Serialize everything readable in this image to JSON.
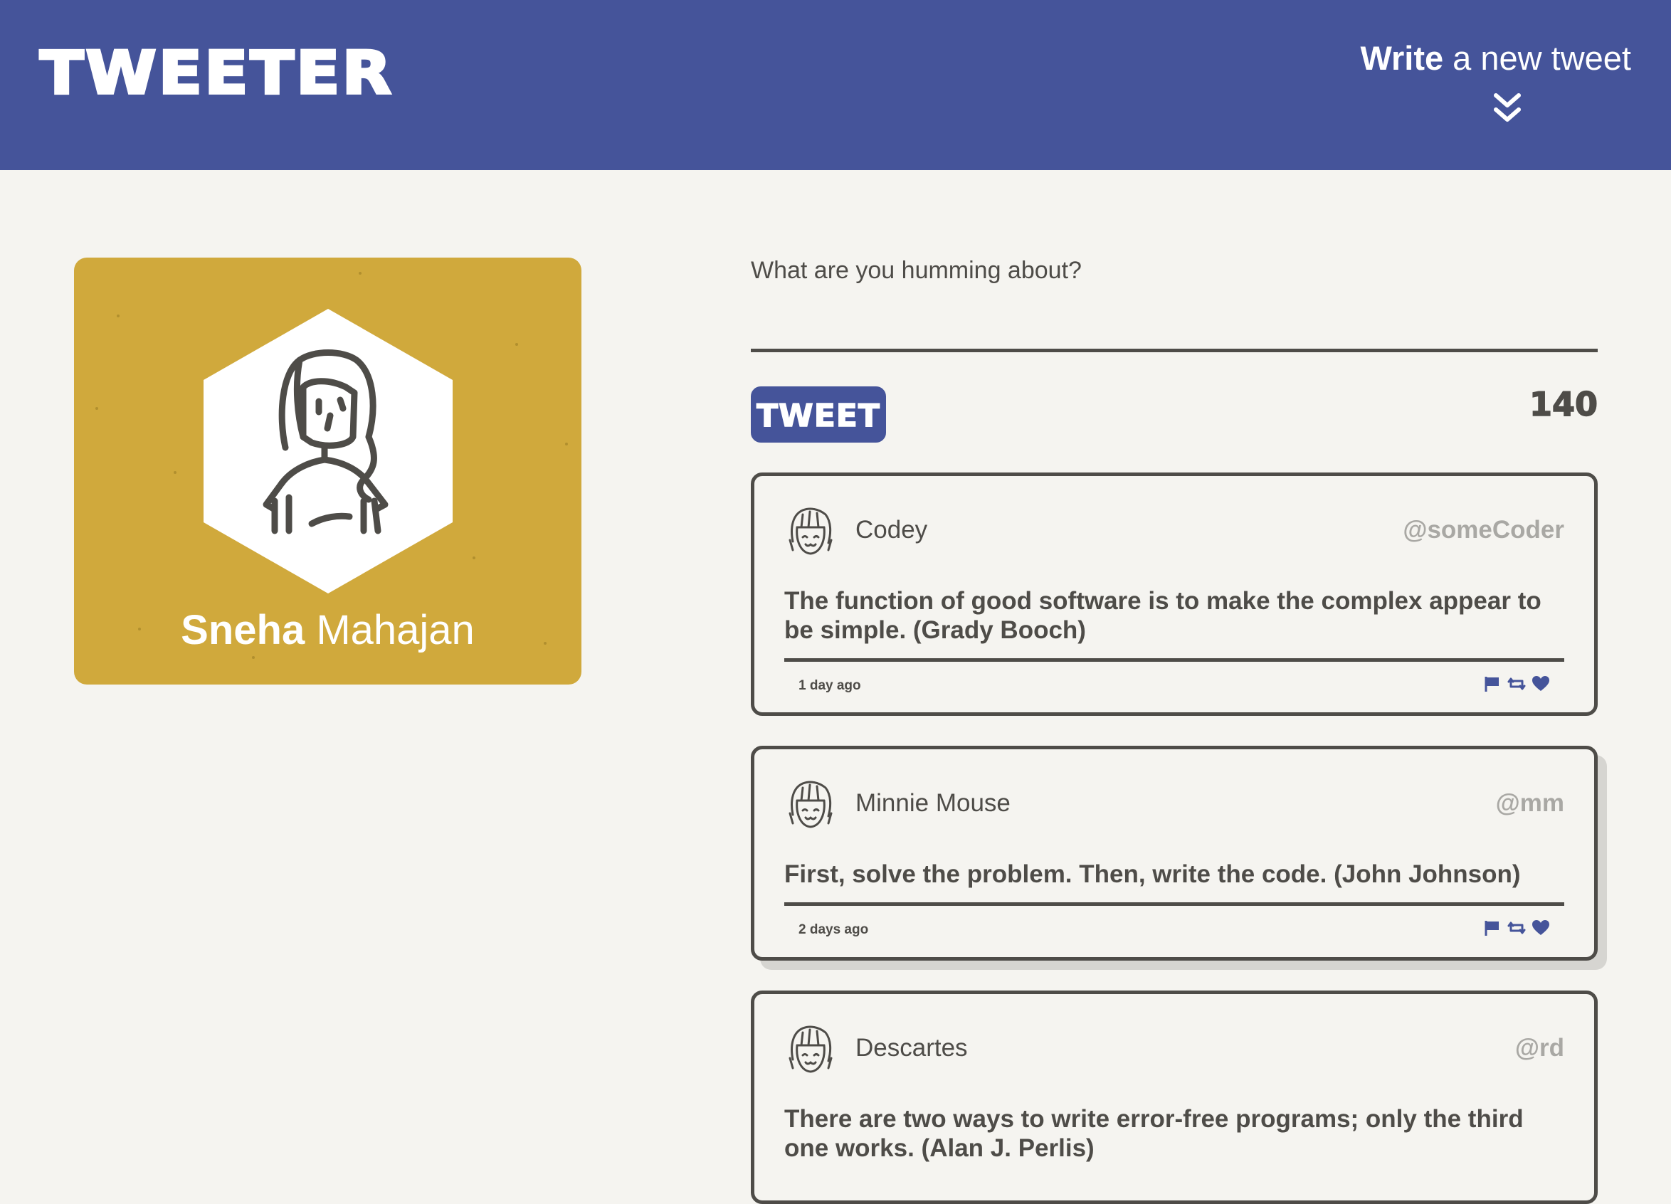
{
  "nav": {
    "brand": "TWEETER",
    "compose_toggle_bold": "Write",
    "compose_toggle_rest": " a new tweet",
    "compose_toggle_icon": "double-chevron-down-icon"
  },
  "profile": {
    "first_name": "Sneha",
    "last_name": " Mahajan",
    "avatar_icon": "user-avatar-icon",
    "card_color": "#d0a93c"
  },
  "compose": {
    "placeholder": "What are you humming about?",
    "value": "",
    "button_label": "TWEET",
    "char_counter": "140"
  },
  "tweets": [
    {
      "name": "Codey",
      "handle": "@someCoder",
      "text": "The function of good software is to make the complex appear to be simple. (Grady Booch)",
      "time": "1 day ago"
    },
    {
      "name": "Minnie Mouse",
      "handle": "@mm",
      "text": "First, solve the problem. Then, write the code. (John Johnson)",
      "time": "2 days ago"
    },
    {
      "name": "Descartes",
      "handle": "@rd",
      "text": "There are two ways to write error-free programs; only the third one works. (Alan J. Perlis)",
      "time": ""
    }
  ],
  "colors": {
    "header": "#45549a",
    "background": "#f5f4f0",
    "text": "#4e4c48",
    "handle": "#a9a8a4",
    "accent": "#45549a"
  }
}
